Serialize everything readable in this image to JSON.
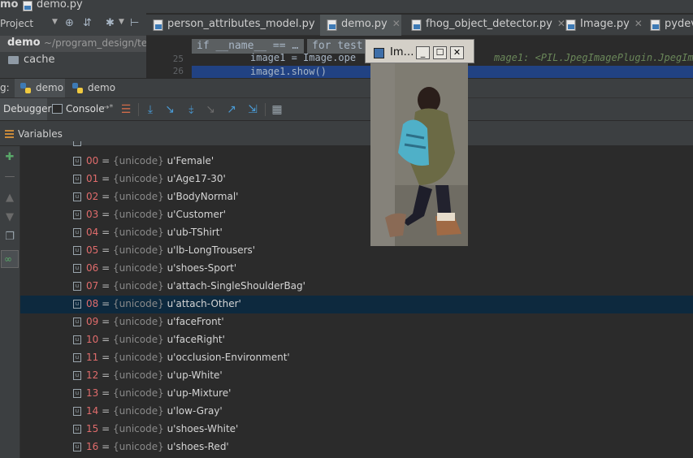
{
  "title": {
    "project_crumb": "mo",
    "file_crumb": "demo.py"
  },
  "project": {
    "label": "Project",
    "root_name": "demo",
    "root_path": "~/program_design/te",
    "folders": [
      "cache"
    ]
  },
  "editor": {
    "tabs": [
      {
        "label": "person_attributes_model.py",
        "active": false
      },
      {
        "label": "demo.py",
        "active": true
      },
      {
        "label": "fhog_object_detector.py",
        "active": false
      },
      {
        "label": "Image.py",
        "active": false
      },
      {
        "label": "pydev",
        "active": false
      }
    ],
    "crumbs": [
      "if __name__ == …",
      "for test"
    ],
    "line_numbers": [
      "25",
      "26"
    ],
    "lines": [
      "image1 = Image.ope",
      "image1.show()"
    ],
    "overflow_hint": "mage1: <PIL.JpegImagePlugin.JpegIma"
  },
  "debug": {
    "prefix": "g:",
    "session_tabs": [
      "demo",
      "demo"
    ],
    "debugger_label": "Debugger",
    "console_label": "Console",
    "variables_label": "Variables"
  },
  "image_window": {
    "title": "Im…"
  },
  "variables": [
    {
      "index": "00",
      "type": "{unicode}",
      "value": "u'Female'"
    },
    {
      "index": "01",
      "type": "{unicode}",
      "value": "u'Age17-30'"
    },
    {
      "index": "02",
      "type": "{unicode}",
      "value": "u'BodyNormal'"
    },
    {
      "index": "03",
      "type": "{unicode}",
      "value": "u'Customer'"
    },
    {
      "index": "04",
      "type": "{unicode}",
      "value": "u'ub-TShirt'"
    },
    {
      "index": "05",
      "type": "{unicode}",
      "value": "u'lb-LongTrousers'"
    },
    {
      "index": "06",
      "type": "{unicode}",
      "value": "u'shoes-Sport'"
    },
    {
      "index": "07",
      "type": "{unicode}",
      "value": "u'attach-SingleShoulderBag'"
    },
    {
      "index": "08",
      "type": "{unicode}",
      "value": "u'attach-Other'",
      "selected": true
    },
    {
      "index": "09",
      "type": "{unicode}",
      "value": "u'faceFront'"
    },
    {
      "index": "10",
      "type": "{unicode}",
      "value": "u'faceRight'"
    },
    {
      "index": "11",
      "type": "{unicode}",
      "value": "u'occlusion-Environment'"
    },
    {
      "index": "12",
      "type": "{unicode}",
      "value": "u'up-White'"
    },
    {
      "index": "13",
      "type": "{unicode}",
      "value": "u'up-Mixture'"
    },
    {
      "index": "14",
      "type": "{unicode}",
      "value": "u'low-Gray'"
    },
    {
      "index": "15",
      "type": "{unicode}",
      "value": "u'shoes-White'"
    },
    {
      "index": "16",
      "type": "{unicode}",
      "value": "u'shoes-Red'"
    }
  ],
  "colors": {
    "background": "#2b2b2b",
    "panel": "#3c3f41",
    "selection": "#0d293e",
    "index_red": "#e06c6c",
    "accent_blue": "#4a9bd6"
  }
}
